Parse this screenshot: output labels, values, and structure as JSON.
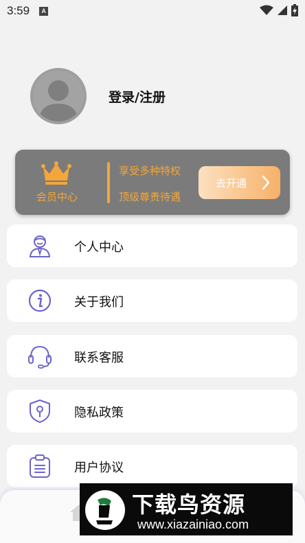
{
  "status_bar": {
    "time": "3:59",
    "notification_letter": "A"
  },
  "profile": {
    "login_label": "登录/注册"
  },
  "vip": {
    "title": "会员中心",
    "line1": "享受多种特权",
    "line2": "顶级尊贵待遇",
    "button_label": "去开通",
    "accent_color": "#f3a63a"
  },
  "menu": {
    "items": [
      {
        "label": "个人中心",
        "icon": "person-icon"
      },
      {
        "label": "关于我们",
        "icon": "info-icon"
      },
      {
        "label": "联系客服",
        "icon": "headset-icon"
      },
      {
        "label": "隐私政策",
        "icon": "shield-icon"
      },
      {
        "label": "用户协议",
        "icon": "clipboard-icon"
      }
    ],
    "icon_color": "#6b63c9"
  },
  "watermark": {
    "title": "下载鸟资源",
    "url": "www.xiazainiao.com"
  }
}
